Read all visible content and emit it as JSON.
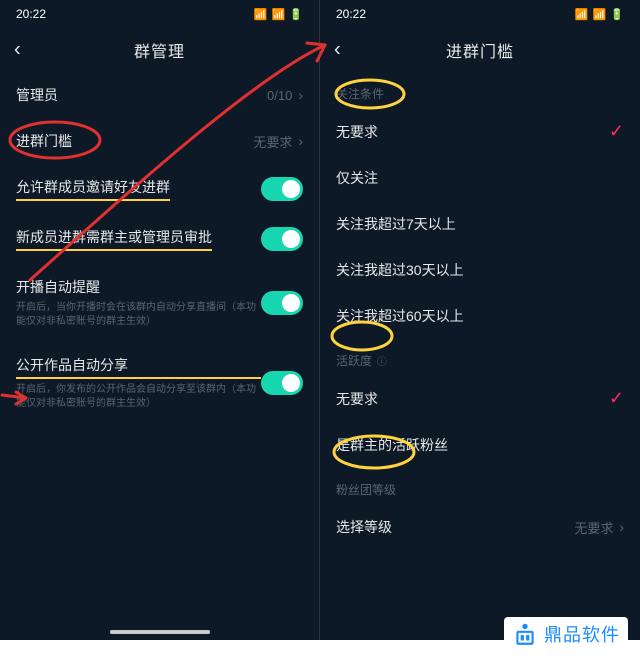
{
  "status": {
    "time": "20:22"
  },
  "left": {
    "title": "群管理",
    "rows": {
      "admin": {
        "label": "管理员",
        "value": "0/10"
      },
      "threshold": {
        "label": "进群门槛",
        "value": "无要求"
      },
      "invite": {
        "label": "允许群成员邀请好友进群"
      },
      "approve": {
        "label": "新成员进群需群主或管理员审批"
      },
      "liveRemind": {
        "label": "开播自动提醒",
        "desc": "开启后，当你开播时会在该群内自动分享直播间（本功能仅对非私密账号的群主生效）"
      },
      "autoShare": {
        "label": "公开作品自动分享",
        "desc": "开启后，你发布的公开作品会自动分享至该群内（本功能仅对非私密账号的群主生效）"
      }
    }
  },
  "right": {
    "title": "进群门槛",
    "sections": {
      "follow": "关注条件",
      "active": "活跃度",
      "fan": "粉丝团等级"
    },
    "opts": {
      "none": "无要求",
      "followOnly": "仅关注",
      "follow7": "关注我超过7天以上",
      "follow30": "关注我超过30天以上",
      "follow60": "关注我超过60天以上",
      "none2": "无要求",
      "activeFan": "是群主的活跃粉丝",
      "pickLevel": "选择等级",
      "pickLevelVal": "无要求"
    }
  },
  "watermark": "鼎品软件"
}
